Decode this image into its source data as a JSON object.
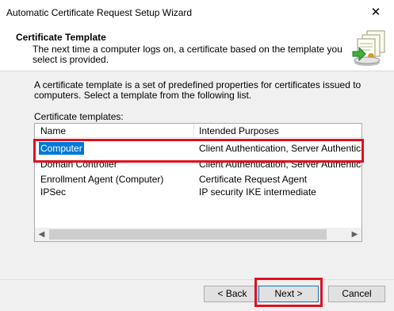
{
  "window": {
    "title": "Automatic Certificate Request Setup Wizard",
    "close_glyph": "✕"
  },
  "header": {
    "title": "Certificate Template",
    "subtitle": "The next time a computer logs on, a certificate based on the template you select is provided.",
    "icon": "certificate-install-icon"
  },
  "body": {
    "intro": "A certificate template is a set of predefined properties for certificates issued to computers. Select a template from the following list.",
    "list_label": "Certificate templates:"
  },
  "list": {
    "columns": [
      "Name",
      "Intended Purposes"
    ],
    "rows": [
      {
        "name": "Computer",
        "purposes": "Client Authentication, Server Authentication",
        "selected": true
      },
      {
        "name": "Domain Controller",
        "purposes": "Client Authentication, Server Authentication"
      },
      {
        "name": "Enrollment Agent (Computer)",
        "purposes": "Certificate Request Agent"
      },
      {
        "name": "IPSec",
        "purposes": "IP security IKE intermediate"
      }
    ],
    "scroll_left": "◀",
    "scroll_right": "▶"
  },
  "buttons": {
    "back": "< Back",
    "next": "Next >",
    "cancel": "Cancel"
  },
  "colors": {
    "selection": "#0078d7",
    "highlight": "#e0101e"
  }
}
